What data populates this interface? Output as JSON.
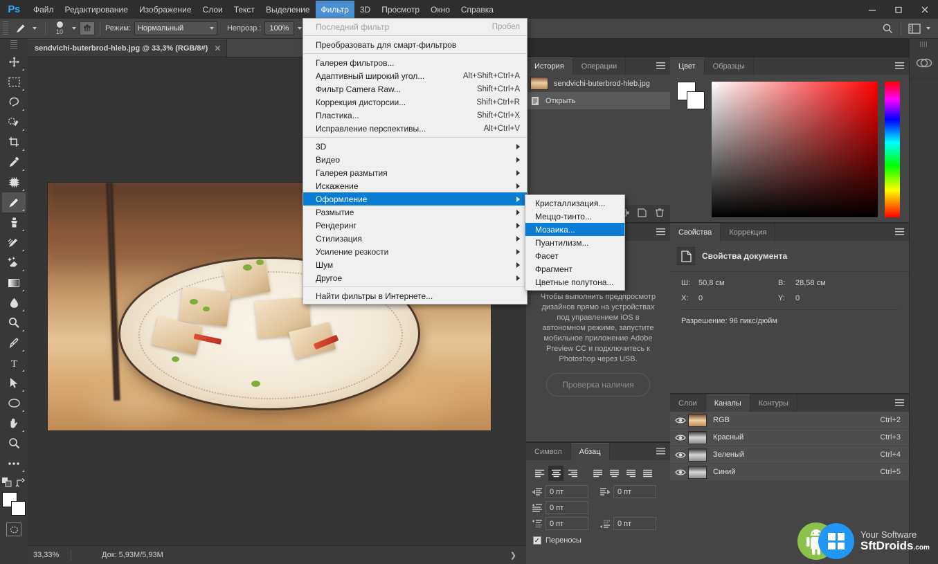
{
  "app": {
    "logo": "Ps"
  },
  "menubar": {
    "items": [
      {
        "label": "Файл",
        "active": false
      },
      {
        "label": "Редактирование",
        "active": false
      },
      {
        "label": "Изображение",
        "active": false
      },
      {
        "label": "Слои",
        "active": false
      },
      {
        "label": "Текст",
        "active": false
      },
      {
        "label": "Выделение",
        "active": false
      },
      {
        "label": "Фильтр",
        "active": true
      },
      {
        "label": "3D",
        "active": false
      },
      {
        "label": "Просмотр",
        "active": false
      },
      {
        "label": "Окно",
        "active": false
      },
      {
        "label": "Справка",
        "active": false
      }
    ],
    "window_controls": [
      "minimize",
      "maximize",
      "close"
    ]
  },
  "options_bar": {
    "brush_size": "10",
    "mode_label": "Режим:",
    "mode_value": "Нормальный",
    "opacity_label": "Непрозр.:",
    "opacity_value": "100%"
  },
  "toolbar": {
    "tools": [
      {
        "name": "move-tool"
      },
      {
        "name": "marquee-tool"
      },
      {
        "name": "lasso-tool"
      },
      {
        "name": "quick-selection-tool"
      },
      {
        "name": "crop-tool"
      },
      {
        "name": "eyedropper-tool"
      },
      {
        "name": "healing-brush-tool"
      },
      {
        "name": "brush-tool",
        "selected": true
      },
      {
        "name": "clone-stamp-tool"
      },
      {
        "name": "history-brush-tool"
      },
      {
        "name": "eraser-tool"
      },
      {
        "name": "gradient-tool"
      },
      {
        "name": "blur-tool"
      },
      {
        "name": "dodge-tool"
      },
      {
        "name": "pen-tool"
      },
      {
        "name": "type-tool"
      },
      {
        "name": "path-selection-tool"
      },
      {
        "name": "ellipse-tool"
      },
      {
        "name": "hand-tool"
      },
      {
        "name": "zoom-tool"
      },
      {
        "name": "more-tools"
      }
    ]
  },
  "document": {
    "tab_title": "sendvichi-buterbrod-hleb.jpg @ 33,3% (RGB/8#)",
    "close_glyph": "✕"
  },
  "status_bar": {
    "zoom": "33,33%",
    "doc_info": "Док: 5,93M/5,93M",
    "arrow": "❯"
  },
  "filter_menu": {
    "sections": [
      [
        {
          "label": "Последний фильтр",
          "shortcut": "Пробел",
          "disabled": true
        }
      ],
      [
        {
          "label": "Преобразовать для смарт-фильтров"
        }
      ],
      [
        {
          "label": "Галерея фильтров..."
        },
        {
          "label": "Адаптивный широкий угол...",
          "shortcut": "Alt+Shift+Ctrl+A"
        },
        {
          "label": "Фильтр Camera Raw...",
          "shortcut": "Shift+Ctrl+A"
        },
        {
          "label": "Коррекция дисторсии...",
          "shortcut": "Shift+Ctrl+R"
        },
        {
          "label": "Пластика...",
          "shortcut": "Shift+Ctrl+X"
        },
        {
          "label": "Исправление перспективы...",
          "shortcut": "Alt+Ctrl+V"
        }
      ],
      [
        {
          "label": "3D",
          "submenu": true
        },
        {
          "label": "Видео",
          "submenu": true
        },
        {
          "label": "Галерея размытия",
          "submenu": true
        },
        {
          "label": "Искажение",
          "submenu": true
        },
        {
          "label": "Оформление",
          "submenu": true,
          "highlighted": true
        },
        {
          "label": "Размытие",
          "submenu": true
        },
        {
          "label": "Рендеринг",
          "submenu": true
        },
        {
          "label": "Стилизация",
          "submenu": true
        },
        {
          "label": "Усиление резкости",
          "submenu": true
        },
        {
          "label": "Шум",
          "submenu": true
        },
        {
          "label": "Другое",
          "submenu": true
        }
      ],
      [
        {
          "label": "Найти фильтры в Интернете..."
        }
      ]
    ],
    "highlight_color": "#0a7cd4"
  },
  "filter_submenu": {
    "items": [
      {
        "label": "Кристаллизация..."
      },
      {
        "label": "Меццо-тинто..."
      },
      {
        "label": "Мозаика...",
        "highlighted": true
      },
      {
        "label": "Пуантилизм..."
      },
      {
        "label": "Фасет"
      },
      {
        "label": "Фрагмент"
      },
      {
        "label": "Цветные полутона..."
      }
    ]
  },
  "history_panel": {
    "tabs": [
      {
        "label": "История",
        "active": true
      },
      {
        "label": "Операции",
        "active": false
      }
    ],
    "rows": [
      {
        "label": "sendvichi-buterbrod-hleb.jpg",
        "type": "snapshot",
        "selected": false
      },
      {
        "label": "Открыть",
        "type": "state",
        "selected": true
      }
    ]
  },
  "libraries_panel": {
    "description": "Чтобы выполнить предпросмотр дизайнов прямо на устройствах под управлением iOS в автономном режиме, запустите мобильное приложение Adobe Preview CC и подключитесь к Photoshop через USB.",
    "button_label": "Проверка наличия"
  },
  "paragraph_panel": {
    "tabs": [
      {
        "label": "Символ",
        "active": false
      },
      {
        "label": "Абзац",
        "active": true
      }
    ],
    "align_buttons": [
      "align-left",
      "align-center",
      "align-right",
      "justify-last-left",
      "justify-last-center",
      "justify-last-right",
      "justify-all"
    ],
    "selected_align_index": 1,
    "fields": [
      {
        "icon": "indent-left-margin",
        "value": "0 пт"
      },
      {
        "icon": "indent-right-margin",
        "value": "0 пт"
      },
      {
        "icon": "indent-first-line",
        "value": "0 пт"
      },
      {
        "icon": "space-before-paragraph",
        "value": "0 пт"
      },
      {
        "icon": "space-after-paragraph",
        "value": "0 пт"
      }
    ],
    "hyphenate_label": "Переносы",
    "hyphenate_checked": true
  },
  "color_panel": {
    "tabs": [
      {
        "label": "Цвет",
        "active": true
      },
      {
        "label": "Образцы",
        "active": false
      }
    ],
    "foreground_color": "#ffffff",
    "background_color": "#ffffff"
  },
  "properties_panel": {
    "tabs": [
      {
        "label": "Свойства",
        "active": true
      },
      {
        "label": "Коррекция",
        "active": false
      }
    ],
    "header": "Свойства документа",
    "rows": [
      [
        {
          "key": "Ш:",
          "value": "50,8 см"
        },
        {
          "key": "В:",
          "value": "28,58 см"
        }
      ],
      [
        {
          "key": "X:",
          "value": "0"
        },
        {
          "key": "Y:",
          "value": "0"
        }
      ]
    ],
    "resolution": "Разрешение: 96 пикс/дюйм"
  },
  "channels_panel": {
    "tabs": [
      {
        "label": "Слои",
        "active": false
      },
      {
        "label": "Каналы",
        "active": true
      },
      {
        "label": "Контуры",
        "active": false
      }
    ],
    "channels": [
      {
        "label": "RGB",
        "shortcut": "Ctrl+2",
        "visible": true,
        "composite": true
      },
      {
        "label": "Красный",
        "shortcut": "Ctrl+3",
        "visible": true,
        "composite": false
      },
      {
        "label": "Зеленый",
        "shortcut": "Ctrl+4",
        "visible": true,
        "composite": false
      },
      {
        "label": "Синий",
        "shortcut": "Ctrl+5",
        "visible": true,
        "composite": false
      }
    ]
  },
  "watermark": {
    "line1": "Your Software",
    "line2_a": "S",
    "line2_b": "ftDroids",
    "line2_dom": ".com"
  }
}
